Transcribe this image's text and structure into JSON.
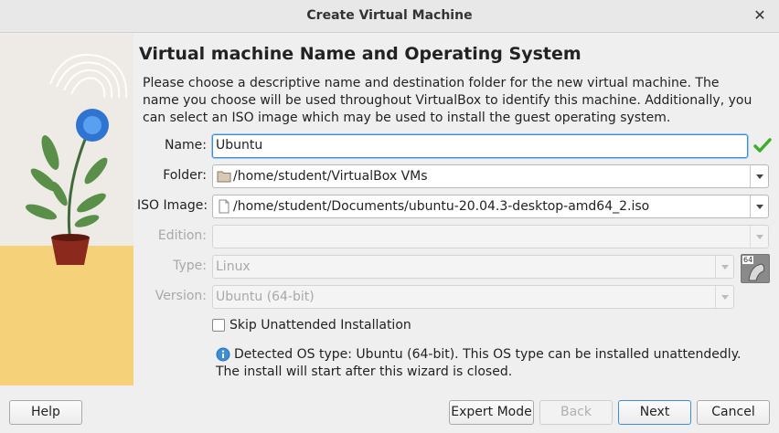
{
  "window": {
    "title": "Create Virtual Machine",
    "close_icon": "close-icon"
  },
  "page": {
    "title": "Virtual machine Name and Operating System",
    "description": "Please choose a descriptive name and destination folder for the new virtual machine. The name you choose will be used throughout VirtualBox to identify this machine. Additionally, you can select an ISO image which may be used to install the guest operating system."
  },
  "form": {
    "name": {
      "label": "Name:",
      "value": "Ubuntu",
      "status_icon": "checkmark-icon"
    },
    "folder": {
      "label": "Folder:",
      "value": "/home/student/VirtualBox VMs",
      "icon": "folder-icon"
    },
    "iso_image": {
      "label": "ISO Image:",
      "value": "/home/student/Documents/ubuntu-20.04.3-desktop-amd64_2.iso",
      "icon": "file-icon"
    },
    "edition": {
      "label": "Edition:",
      "value": "",
      "enabled": false
    },
    "type": {
      "label": "Type:",
      "value": "Linux",
      "enabled": false
    },
    "version": {
      "label": "Version:",
      "value": "Ubuntu (64-bit)",
      "enabled": false,
      "os_badge": "64"
    },
    "skip_unattended": {
      "label": "Skip Unattended Installation",
      "checked": false
    }
  },
  "info": {
    "icon": "info-icon",
    "text": "Detected OS type: Ubuntu (64-bit). This OS type can be installed unattendedly. The install will start after this wizard is closed."
  },
  "buttons": {
    "help": "Help",
    "expert_mode": "Expert Mode",
    "back": "Back",
    "next": "Next",
    "cancel": "Cancel"
  },
  "colors": {
    "accent": "#3a8fd6",
    "valid_check": "#3fae2a",
    "disabled_text": "#a8a8a8"
  }
}
